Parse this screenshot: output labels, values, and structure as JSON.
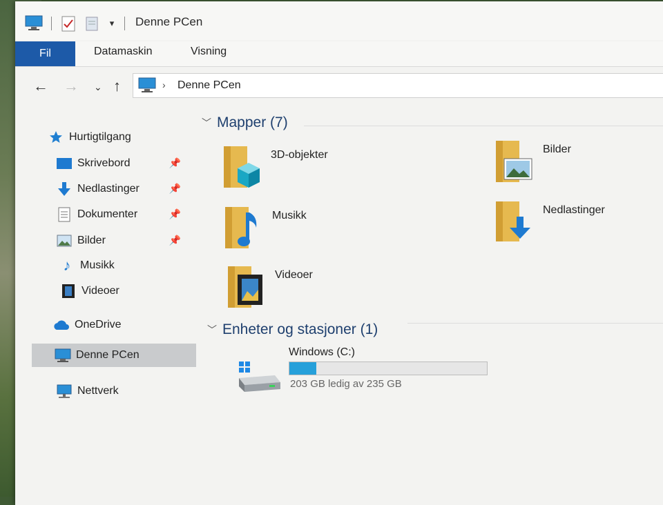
{
  "window": {
    "title": "Denne PCen"
  },
  "ribbon": {
    "tabs": [
      "Fil",
      "Datamaskin",
      "Visning"
    ]
  },
  "address": {
    "path": "Denne PCen"
  },
  "sidebar": {
    "quick_access": "Hurtigtilgang",
    "items": [
      {
        "label": "Skrivebord",
        "icon": "desktop-icon",
        "pinned": true
      },
      {
        "label": "Nedlastinger",
        "icon": "download-icon",
        "pinned": true
      },
      {
        "label": "Dokumenter",
        "icon": "document-icon",
        "pinned": true
      },
      {
        "label": "Bilder",
        "icon": "pictures-icon",
        "pinned": true
      },
      {
        "label": "Musikk",
        "icon": "music-icon",
        "pinned": false
      },
      {
        "label": "Videoer",
        "icon": "video-icon",
        "pinned": false
      }
    ],
    "onedrive": "OneDrive",
    "this_pc": "Denne PCen",
    "network": "Nettverk"
  },
  "content": {
    "folders_header": "Mapper (7)",
    "folders": [
      {
        "label": "3D-objekter",
        "icon": "3d-objects-folder-icon"
      },
      {
        "label": "Bilder",
        "icon": "pictures-folder-icon"
      },
      {
        "label": "Musikk",
        "icon": "music-folder-icon"
      },
      {
        "label": "Nedlastinger",
        "icon": "downloads-folder-icon"
      },
      {
        "label": "Videoer",
        "icon": "videos-folder-icon"
      }
    ],
    "devices_header": "Enheter og stasjoner (1)",
    "drive": {
      "label": "Windows (C:)",
      "free_text": "203 GB ledig av 235 GB",
      "used_fraction": 0.136
    }
  },
  "colors": {
    "accent": "#1d5aa8",
    "drive_bar": "#26a0da",
    "header_text": "#1e3f6e",
    "selected": "#c9cbcd"
  }
}
